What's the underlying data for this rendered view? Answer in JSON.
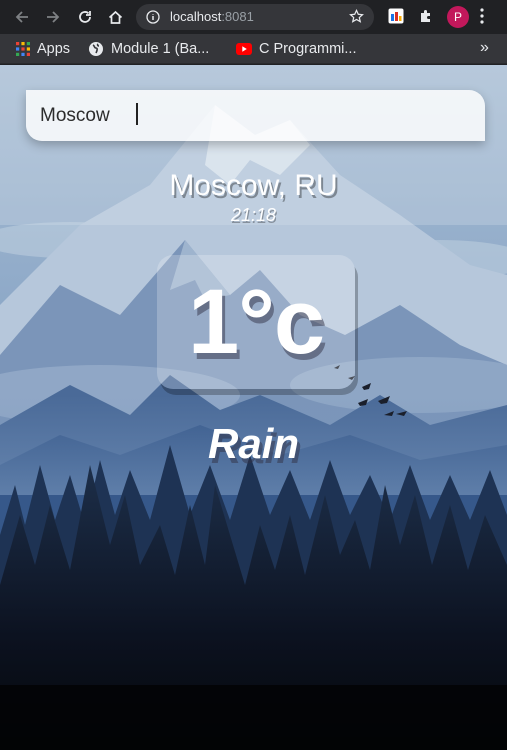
{
  "browser": {
    "url_host": "localhost",
    "url_port": ":8081",
    "profile_initial": "P",
    "bookmarks": [
      {
        "label": "Apps",
        "icon": "apps-grid-icon"
      },
      {
        "label": "Module 1 (Ba...",
        "icon": "globe-icon"
      },
      {
        "label": "C Programmi...",
        "icon": "youtube-icon"
      }
    ],
    "more": "»"
  },
  "app": {
    "search_value": "Moscow",
    "location": "Moscow, RU",
    "time": "21:18",
    "temperature": "1°c",
    "condition": "Rain"
  },
  "colors": {
    "chrome_dark": "#202124",
    "bookmarks_bar": "#35363a",
    "profile": "#c2185b",
    "sky": "#8aa8c8",
    "mountain_dark": "#2c4b78"
  }
}
